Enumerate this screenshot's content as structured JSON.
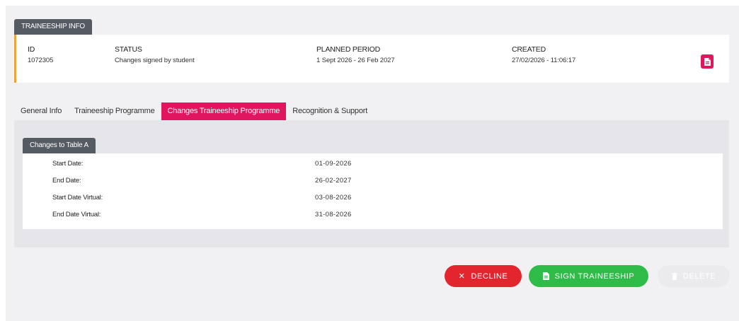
{
  "traineeship_info": {
    "tab_label": "TRAINEESHIP INFO",
    "id_label": "ID",
    "id_value": "1072305",
    "status_label": "STATUS",
    "status_value": "Changes signed by student",
    "period_label": "PLANNED PERIOD",
    "period_value": "1 Sept 2026 - 26 Feb 2027",
    "created_label": "CREATED",
    "created_value": "27/02/2026 - 11:06:17",
    "pdf_icon": "pdf-document-icon"
  },
  "tabs": [
    {
      "label": "General Info",
      "active": false
    },
    {
      "label": "Traineeship Programme",
      "active": false
    },
    {
      "label": "Changes Traineeship Programme",
      "active": true
    },
    {
      "label": "Recognition & Support",
      "active": false
    }
  ],
  "changes": {
    "tab_label": "Changes to Table A",
    "rows": [
      {
        "label": "Start Date:",
        "value": "01-09-2026"
      },
      {
        "label": "End Date:",
        "value": "26-02-2027"
      },
      {
        "label": "Start Date Virtual:",
        "value": "03-08-2026"
      },
      {
        "label": "End Date Virtual:",
        "value": "31-08-2026"
      }
    ]
  },
  "actions": {
    "decline_label": "DECLINE",
    "sign_label": "SIGN TRAINEESHIP",
    "delete_label": "DELETE"
  },
  "colors": {
    "accent": "#e0175f",
    "decline": "#e3262e",
    "sign": "#2ebb47",
    "status_border": "#f0a23c"
  }
}
